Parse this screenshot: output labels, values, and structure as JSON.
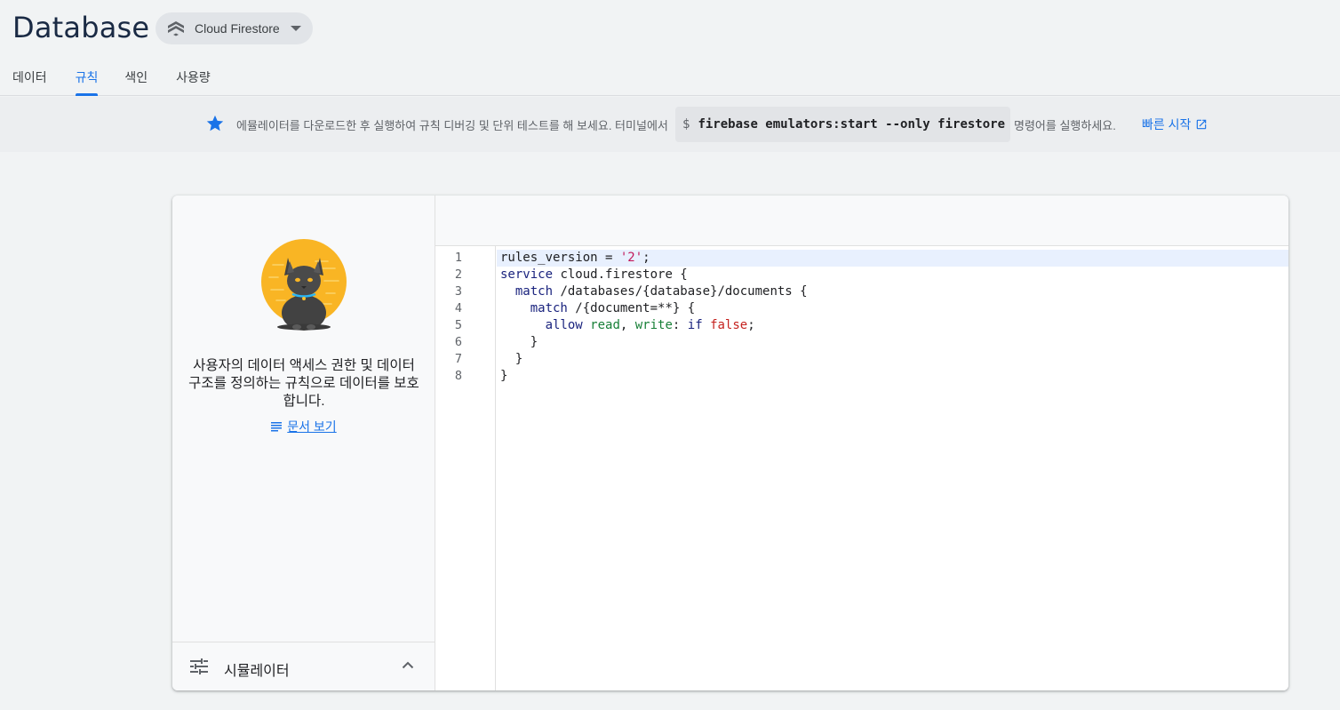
{
  "header": {
    "title": "Database",
    "db_selector_label": "Cloud Firestore"
  },
  "tabs": [
    {
      "label": "데이터"
    },
    {
      "label": "규칙"
    },
    {
      "label": "색인"
    },
    {
      "label": "사용량"
    }
  ],
  "active_tab": "규칙",
  "banner": {
    "message": "에뮬레이터를 다운로드한 후 실행하여 규칙 디버깅 및 단위 테스트를 해 보세요. 터미널에서",
    "command_prompt": "$",
    "command": "firebase emulators:start --only firestore",
    "message_suffix": "명령어를 실행하세요.",
    "quickstart_label": "빠른 시작"
  },
  "left_panel": {
    "description": "사용자의 데이터 액세스 권한 및 데이터 구조를 정의하는 규칙으로 데이터를 보호합니다.",
    "docs_link": "문서 보기",
    "simulator_label": "시뮬레이터"
  },
  "editor": {
    "line_numbers": [
      "1",
      "2",
      "3",
      "4",
      "5",
      "6",
      "7",
      "8"
    ],
    "lines": [
      "rules_version = '2';",
      "service cloud.firestore {",
      "  match /databases/{database}/documents {",
      "    match /{document=**} {",
      "      allow read, write: if false;",
      "    }",
      "  }",
      "}"
    ]
  },
  "colors": {
    "accent": "#1a73e8",
    "keyword": "#1a237e",
    "string": "#c2185b",
    "permission": "#188038",
    "boolean": "#c5221f",
    "star": "#1a73e8"
  },
  "icons": {
    "db_selector": "firestore-logo-icon",
    "banner": "star-icon",
    "quickstart": "open-in-new-icon",
    "docs": "notes-icon",
    "simulator": "tune-icon",
    "simulator_toggle": "chevron-up-icon"
  }
}
